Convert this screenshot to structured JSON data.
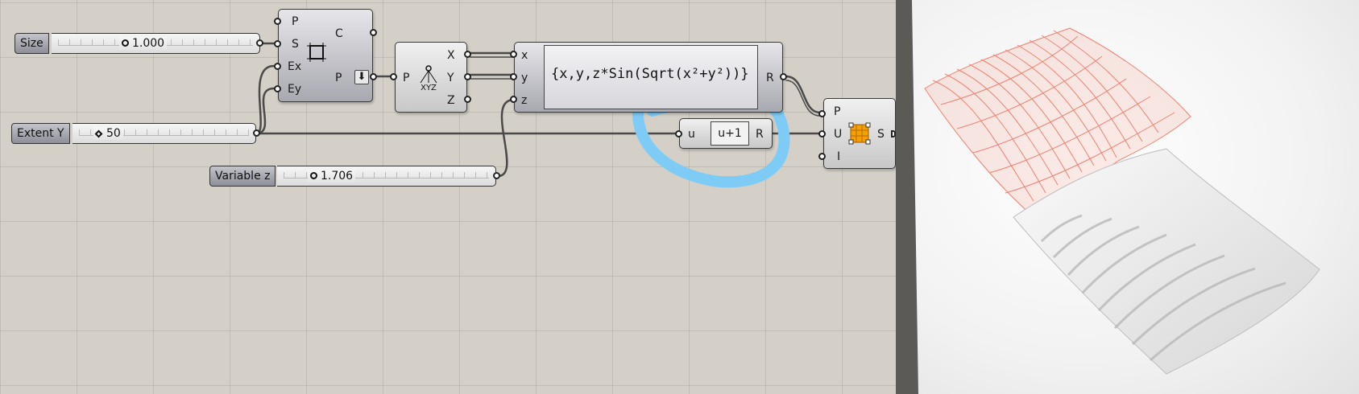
{
  "sliders": {
    "size": {
      "label": "Size",
      "value": "1.000"
    },
    "extent_y": {
      "label": "Extent Y",
      "value": "50"
    },
    "variable_z": {
      "label": "Variable z",
      "value": "1.706"
    }
  },
  "rectangle": {
    "inputs": [
      "P",
      "S",
      "Ex",
      "Ey"
    ],
    "outputs": [
      "C",
      "P"
    ]
  },
  "deconstruct": {
    "input": "P",
    "outputs": [
      "X",
      "Y",
      "Z"
    ],
    "icon_text": "XYZ"
  },
  "expression": {
    "inputs": [
      "x",
      "y",
      "z"
    ],
    "text": "{x,y,z*Sin(Sqrt(x²+y²))}",
    "output": "R"
  },
  "increment": {
    "input": "u",
    "text": "u+1",
    "output": "R"
  },
  "surface": {
    "inputs": [
      "P",
      "U",
      "I"
    ],
    "output": "S"
  },
  "colors": {
    "canvas": "#d4d0c8",
    "wire": "#4a4a4a",
    "highlight": "#7ecbf5",
    "mesh": "#f08070",
    "surface": "#e8e8e8"
  },
  "icons": [
    "rectangle-icon",
    "deconstruct-point-icon",
    "surface-from-points-icon",
    "parameter-output-arrow-icon"
  ]
}
